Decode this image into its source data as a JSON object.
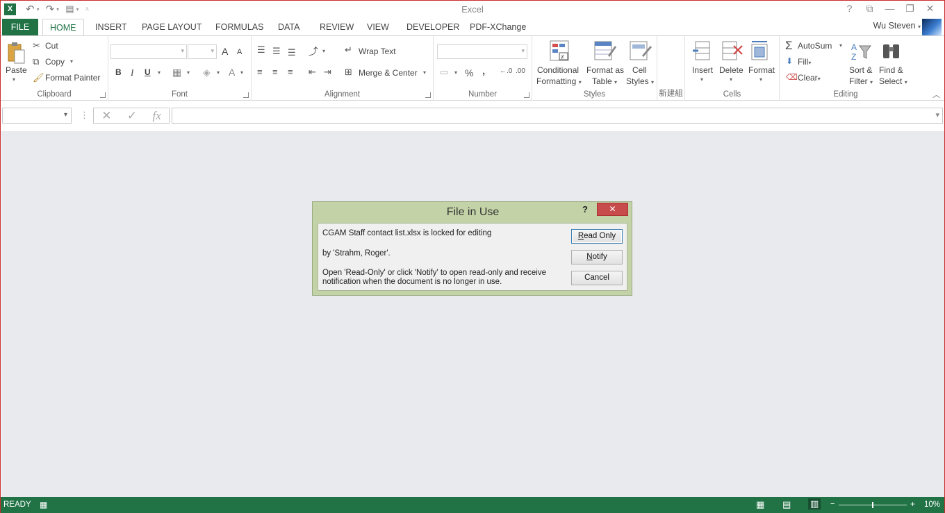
{
  "app": {
    "title": "Excel",
    "logo": "X",
    "user_name": "Wu Steven"
  },
  "tabs": [
    "FILE",
    "HOME",
    "INSERT",
    "PAGE LAYOUT",
    "FORMULAS",
    "DATA",
    "REVIEW",
    "VIEW",
    "DEVELOPER",
    "PDF-XChange"
  ],
  "ribbon": {
    "clipboard": {
      "label": "Clipboard",
      "paste": "Paste",
      "cut": "Cut",
      "copy": "Copy",
      "format_painter": "Format Painter"
    },
    "font": {
      "label": "Font",
      "bold": "B",
      "italic": "I",
      "underline": "U",
      "grow": "A",
      "shrink": "A",
      "color": "A"
    },
    "alignment": {
      "label": "Alignment",
      "wrap_text": "Wrap Text",
      "merge_center": "Merge & Center"
    },
    "number": {
      "label": "Number",
      "percent": "%",
      "comma": ","
    },
    "styles": {
      "label": "Styles",
      "conditional_1": "Conditional",
      "conditional_2": "Formatting",
      "format_table_1": "Format as",
      "format_table_2": "Table",
      "cell_styles_1": "Cell",
      "cell_styles_2": "Styles"
    },
    "new_group": {
      "label": "新建組"
    },
    "cells": {
      "label": "Cells",
      "insert": "Insert",
      "delete": "Delete",
      "format": "Format"
    },
    "editing": {
      "label": "Editing",
      "autosum": "AutoSum",
      "fill": "Fill",
      "clear": "Clear",
      "sort_1": "Sort &",
      "sort_2": "Filter",
      "find_1": "Find &",
      "find_2": "Select"
    }
  },
  "formula_bar": {
    "fx": "fx",
    "cancel": "✕",
    "enter": "✓"
  },
  "dialog": {
    "title": "File in Use",
    "help": "?",
    "close": "✕",
    "line1": "CGAM Staff contact list.xlsx is locked for editing",
    "line2": "by 'Strahm, Roger'.",
    "line3": "Open 'Read-Only' or click 'Notify' to open read-only and receive",
    "line4": "notification when the document is no longer in use.",
    "read_only_mnemonic": "R",
    "read_only_rest": "ead Only",
    "notify_mnemonic": "N",
    "notify_rest": "otify",
    "cancel": "Cancel"
  },
  "status": {
    "ready": "READY",
    "zoom": "10%"
  },
  "colors": {
    "accent": "#217346",
    "dialog_bg": "#c3d3a7",
    "close_red": "#c74b4b"
  }
}
